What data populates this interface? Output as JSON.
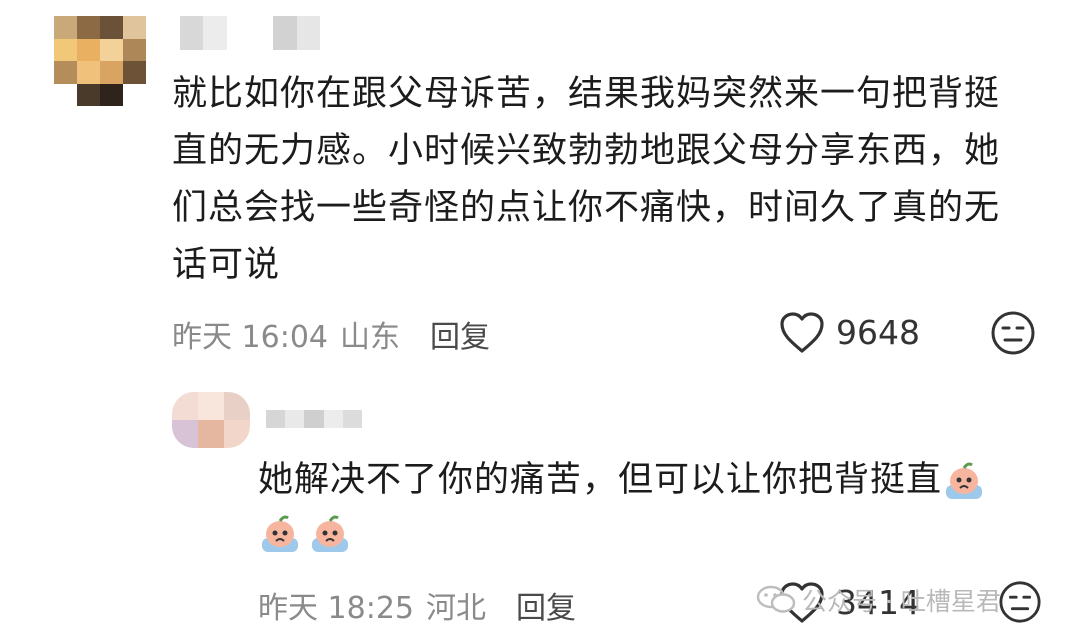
{
  "comment1": {
    "text_lines": [
      "就比如你在跟父母诉苦，结果我妈突然来一句把背挺",
      "直的无力感。小时候兴致勃勃地跟父母分享东西，她",
      "们总会找一些奇怪的点让你不痛快，时间久了真的无",
      "话可说"
    ],
    "time": "昨天 16:04",
    "location": "山东",
    "reply_label": "回复",
    "likes": "9648"
  },
  "comment2": {
    "text": "她解决不了你的痛苦，但可以让你把背挺直",
    "time": "昨天 18:25",
    "location": "河北",
    "reply_label": "回复",
    "likes": "3414"
  },
  "icons": {
    "heart": "heart-icon",
    "reaction": "meh-face-icon",
    "emoji": "crying-peach-emoji",
    "watermark": "wechat-icon"
  },
  "watermark": {
    "text": "公众号 · 吐槽星君"
  },
  "colors": {
    "text": "#1c1c1c",
    "meta": "#8a8a8a",
    "icon": "#333333"
  }
}
